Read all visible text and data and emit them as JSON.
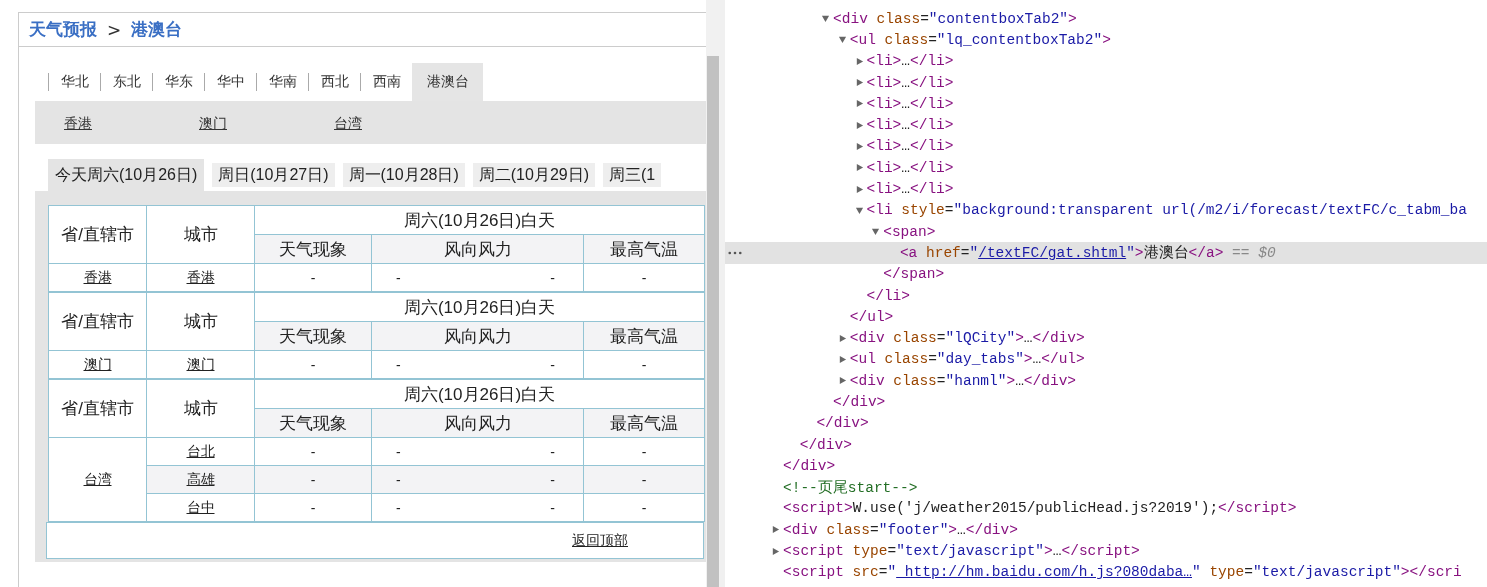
{
  "breadcrumb": {
    "home": "天气预报",
    "separator": ">",
    "current": "港澳台"
  },
  "region_tabs": [
    {
      "label": "华北",
      "selected": false
    },
    {
      "label": "东北",
      "selected": false
    },
    {
      "label": "华东",
      "selected": false
    },
    {
      "label": "华中",
      "selected": false
    },
    {
      "label": "华南",
      "selected": false
    },
    {
      "label": "西北",
      "selected": false
    },
    {
      "label": "西南",
      "selected": false
    },
    {
      "label": "港澳台",
      "selected": true
    }
  ],
  "city_links": [
    "香港",
    "澳门",
    "台湾"
  ],
  "day_tabs": [
    {
      "label": "今天周六(10月26日)",
      "selected": true
    },
    {
      "label": "周日(10月27日)",
      "selected": false
    },
    {
      "label": "周一(10月28日)",
      "selected": false
    },
    {
      "label": "周二(10月29日)",
      "selected": false
    },
    {
      "label": "周三(1",
      "selected": false
    }
  ],
  "tables": [
    {
      "header": {
        "province": "省/直辖市",
        "city": "城市",
        "period": "周六(10月26日)白天",
        "columns": [
          "天气现象",
          "风向风力",
          "最高气温"
        ]
      },
      "province": "香港",
      "rows": [
        {
          "city": "香港",
          "weather": "-",
          "wind_direction": "-",
          "wind_force": "-",
          "high_temp": "-",
          "highlighted": false
        }
      ]
    },
    {
      "header": {
        "province": "省/直辖市",
        "city": "城市",
        "period": "周六(10月26日)白天",
        "columns": [
          "天气现象",
          "风向风力",
          "最高气温"
        ]
      },
      "province": "澳门",
      "rows": [
        {
          "city": "澳门",
          "weather": "-",
          "wind_direction": "-",
          "wind_force": "-",
          "high_temp": "-",
          "highlighted": false
        }
      ]
    },
    {
      "header": {
        "province": "省/直辖市",
        "city": "城市",
        "period": "周六(10月26日)白天",
        "columns": [
          "天气现象",
          "风向风力",
          "最高气温"
        ]
      },
      "province": "台湾",
      "rows": [
        {
          "city": "台北",
          "weather": "-",
          "wind_direction": "-",
          "wind_force": "-",
          "high_temp": "-",
          "highlighted": false
        },
        {
          "city": "高雄",
          "weather": "-",
          "wind_direction": "-",
          "wind_force": "-",
          "high_temp": "-",
          "highlighted": true
        },
        {
          "city": "台中",
          "weather": "-",
          "wind_direction": "-",
          "wind_force": "-",
          "high_temp": "-",
          "highlighted": false
        }
      ]
    }
  ],
  "back_to_top": "返回顶部",
  "devtools": {
    "nodes": [
      {
        "selected": false,
        "close": [
          {
            "kind": "tag",
            "text": "</div>"
          }
        ],
        "children": [
          {
            "selected": false,
            "close": [
              {
                "kind": "tag",
                "text": "</div>"
              }
            ],
            "children": [
              {
                "selected": false,
                "close": [
                  {
                    "kind": "tag",
                    "text": "</div>"
                  }
                ],
                "children": [
                  {
                    "selected": false,
                    "expanded": true,
                    "line": [
                      {
                        "kind": "tag",
                        "text": "<div"
                      },
                      {
                        "kind": "attr",
                        "text": " class"
                      },
                      {
                        "kind": "punct",
                        "text": "="
                      },
                      {
                        "kind": "value",
                        "text": "\"contentboxTab2\""
                      },
                      {
                        "kind": "tag",
                        "text": ">"
                      }
                    ],
                    "close": [
                      {
                        "kind": "tag",
                        "text": "</div>"
                      }
                    ],
                    "children": [
                      {
                        "selected": false,
                        "expanded": true,
                        "line": [
                          {
                            "kind": "tag",
                            "text": "<ul"
                          },
                          {
                            "kind": "attr",
                            "text": " class"
                          },
                          {
                            "kind": "punct",
                            "text": "="
                          },
                          {
                            "kind": "value",
                            "text": "\"lq_contentboxTab2\""
                          },
                          {
                            "kind": "tag",
                            "text": ">"
                          }
                        ],
                        "close": [
                          {
                            "kind": "tag",
                            "text": "</ul>"
                          }
                        ],
                        "children": [
                          {
                            "selected": false,
                            "expanded": false,
                            "line": [
                              {
                                "kind": "tag",
                                "text": "<li>"
                              },
                              {
                                "kind": "text",
                                "text": "…"
                              },
                              {
                                "kind": "tag",
                                "text": "</li>"
                              }
                            ]
                          },
                          {
                            "selected": false,
                            "expanded": false,
                            "line": [
                              {
                                "kind": "tag",
                                "text": "<li>"
                              },
                              {
                                "kind": "text",
                                "text": "…"
                              },
                              {
                                "kind": "tag",
                                "text": "</li>"
                              }
                            ]
                          },
                          {
                            "selected": false,
                            "expanded": false,
                            "line": [
                              {
                                "kind": "tag",
                                "text": "<li>"
                              },
                              {
                                "kind": "text",
                                "text": "…"
                              },
                              {
                                "kind": "tag",
                                "text": "</li>"
                              }
                            ]
                          },
                          {
                            "selected": false,
                            "expanded": false,
                            "line": [
                              {
                                "kind": "tag",
                                "text": "<li>"
                              },
                              {
                                "kind": "text",
                                "text": "…"
                              },
                              {
                                "kind": "tag",
                                "text": "</li>"
                              }
                            ]
                          },
                          {
                            "selected": false,
                            "expanded": false,
                            "line": [
                              {
                                "kind": "tag",
                                "text": "<li>"
                              },
                              {
                                "kind": "text",
                                "text": "…"
                              },
                              {
                                "kind": "tag",
                                "text": "</li>"
                              }
                            ]
                          },
                          {
                            "selected": false,
                            "expanded": false,
                            "line": [
                              {
                                "kind": "tag",
                                "text": "<li>"
                              },
                              {
                                "kind": "text",
                                "text": "…"
                              },
                              {
                                "kind": "tag",
                                "text": "</li>"
                              }
                            ]
                          },
                          {
                            "selected": false,
                            "expanded": false,
                            "line": [
                              {
                                "kind": "tag",
                                "text": "<li>"
                              },
                              {
                                "kind": "text",
                                "text": "…"
                              },
                              {
                                "kind": "tag",
                                "text": "</li>"
                              }
                            ]
                          },
                          {
                            "selected": false,
                            "expanded": true,
                            "line": [
                              {
                                "kind": "tag",
                                "text": "<li"
                              },
                              {
                                "kind": "attr",
                                "text": " style"
                              },
                              {
                                "kind": "punct",
                                "text": "="
                              },
                              {
                                "kind": "value",
                                "text": "\"background:transparent url(/m2/i/forecast/textFC/c_tabm_ba"
                              }
                            ],
                            "close": [
                              {
                                "kind": "tag",
                                "text": "</li>"
                              }
                            ],
                            "children": [
                              {
                                "selected": false,
                                "expanded": true,
                                "line": [
                                  {
                                    "kind": "tag",
                                    "text": "<span>"
                                  }
                                ],
                                "close": [
                                  {
                                    "kind": "tag",
                                    "text": "</span>"
                                  }
                                ],
                                "children": [
                                  {
                                    "selected": true,
                                    "line": [
                                      {
                                        "kind": "tag",
                                        "text": "<a"
                                      },
                                      {
                                        "kind": "attr",
                                        "text": " href"
                                      },
                                      {
                                        "kind": "punct",
                                        "text": "="
                                      },
                                      {
                                        "kind": "value",
                                        "text": "\""
                                      },
                                      {
                                        "kind": "link",
                                        "text": "/textFC/gat.shtml"
                                      },
                                      {
                                        "kind": "value",
                                        "text": "\""
                                      },
                                      {
                                        "kind": "tag",
                                        "text": ">"
                                      },
                                      {
                                        "kind": "text",
                                        "text": "港澳台"
                                      },
                                      {
                                        "kind": "tag",
                                        "text": "</a>"
                                      },
                                      {
                                        "kind": "hint",
                                        "text": " == $0"
                                      }
                                    ]
                                  }
                                ]
                              }
                            ]
                          }
                        ]
                      },
                      {
                        "selected": false,
                        "expanded": false,
                        "line": [
                          {
                            "kind": "tag",
                            "text": "<div"
                          },
                          {
                            "kind": "attr",
                            "text": " class"
                          },
                          {
                            "kind": "punct",
                            "text": "="
                          },
                          {
                            "kind": "value",
                            "text": "\"lQCity\""
                          },
                          {
                            "kind": "tag",
                            "text": ">"
                          },
                          {
                            "kind": "text",
                            "text": "…"
                          },
                          {
                            "kind": "tag",
                            "text": "</div>"
                          }
                        ]
                      },
                      {
                        "selected": false,
                        "expanded": false,
                        "line": [
                          {
                            "kind": "tag",
                            "text": "<ul"
                          },
                          {
                            "kind": "attr",
                            "text": " class"
                          },
                          {
                            "kind": "punct",
                            "text": "="
                          },
                          {
                            "kind": "value",
                            "text": "\"day_tabs\""
                          },
                          {
                            "kind": "tag",
                            "text": ">"
                          },
                          {
                            "kind": "text",
                            "text": "…"
                          },
                          {
                            "kind": "tag",
                            "text": "</ul>"
                          }
                        ]
                      },
                      {
                        "selected": false,
                        "expanded": false,
                        "line": [
                          {
                            "kind": "tag",
                            "text": "<div"
                          },
                          {
                            "kind": "attr",
                            "text": " class"
                          },
                          {
                            "kind": "punct",
                            "text": "="
                          },
                          {
                            "kind": "value",
                            "text": "\"hanml\""
                          },
                          {
                            "kind": "tag",
                            "text": ">"
                          },
                          {
                            "kind": "text",
                            "text": "…"
                          },
                          {
                            "kind": "tag",
                            "text": "</div>"
                          }
                        ]
                      }
                    ]
                  }
                ]
              }
            ]
          }
        ]
      },
      {
        "selected": false,
        "line": [
          {
            "kind": "comment",
            "text": "<!--页尾start-->"
          }
        ]
      },
      {
        "selected": false,
        "line": [
          {
            "kind": "tag",
            "text": "<script>"
          },
          {
            "kind": "text",
            "text": "W.use('j/weather2015/publicHead.js?2019');"
          },
          {
            "kind": "tag",
            "text": "</script>"
          }
        ]
      },
      {
        "selected": false,
        "expanded": false,
        "line": [
          {
            "kind": "tag",
            "text": "<div"
          },
          {
            "kind": "attr",
            "text": " class"
          },
          {
            "kind": "punct",
            "text": "="
          },
          {
            "kind": "value",
            "text": "\"footer\""
          },
          {
            "kind": "tag",
            "text": ">"
          },
          {
            "kind": "text",
            "text": "…"
          },
          {
            "kind": "tag",
            "text": "</div>"
          }
        ]
      },
      {
        "selected": false,
        "expanded": false,
        "line": [
          {
            "kind": "tag",
            "text": "<script"
          },
          {
            "kind": "attr",
            "text": " type"
          },
          {
            "kind": "punct",
            "text": "="
          },
          {
            "kind": "value",
            "text": "\"text/javascript\""
          },
          {
            "kind": "tag",
            "text": ">"
          },
          {
            "kind": "text",
            "text": "…"
          },
          {
            "kind": "tag",
            "text": "</script>"
          }
        ]
      },
      {
        "selected": false,
        "line": [
          {
            "kind": "tag",
            "text": "<script"
          },
          {
            "kind": "attr",
            "text": " src"
          },
          {
            "kind": "punct",
            "text": "="
          },
          {
            "kind": "value",
            "text": "\""
          },
          {
            "kind": "link",
            "text": " http://hm.baidu.com/h.js?080daba…"
          },
          {
            "kind": "value",
            "text": "\""
          },
          {
            "kind": "attr",
            "text": " type"
          },
          {
            "kind": "punct",
            "text": "="
          },
          {
            "kind": "value",
            "text": "\"text/javascript\""
          },
          {
            "kind": "tag",
            "text": "></scri"
          }
        ]
      }
    ]
  }
}
